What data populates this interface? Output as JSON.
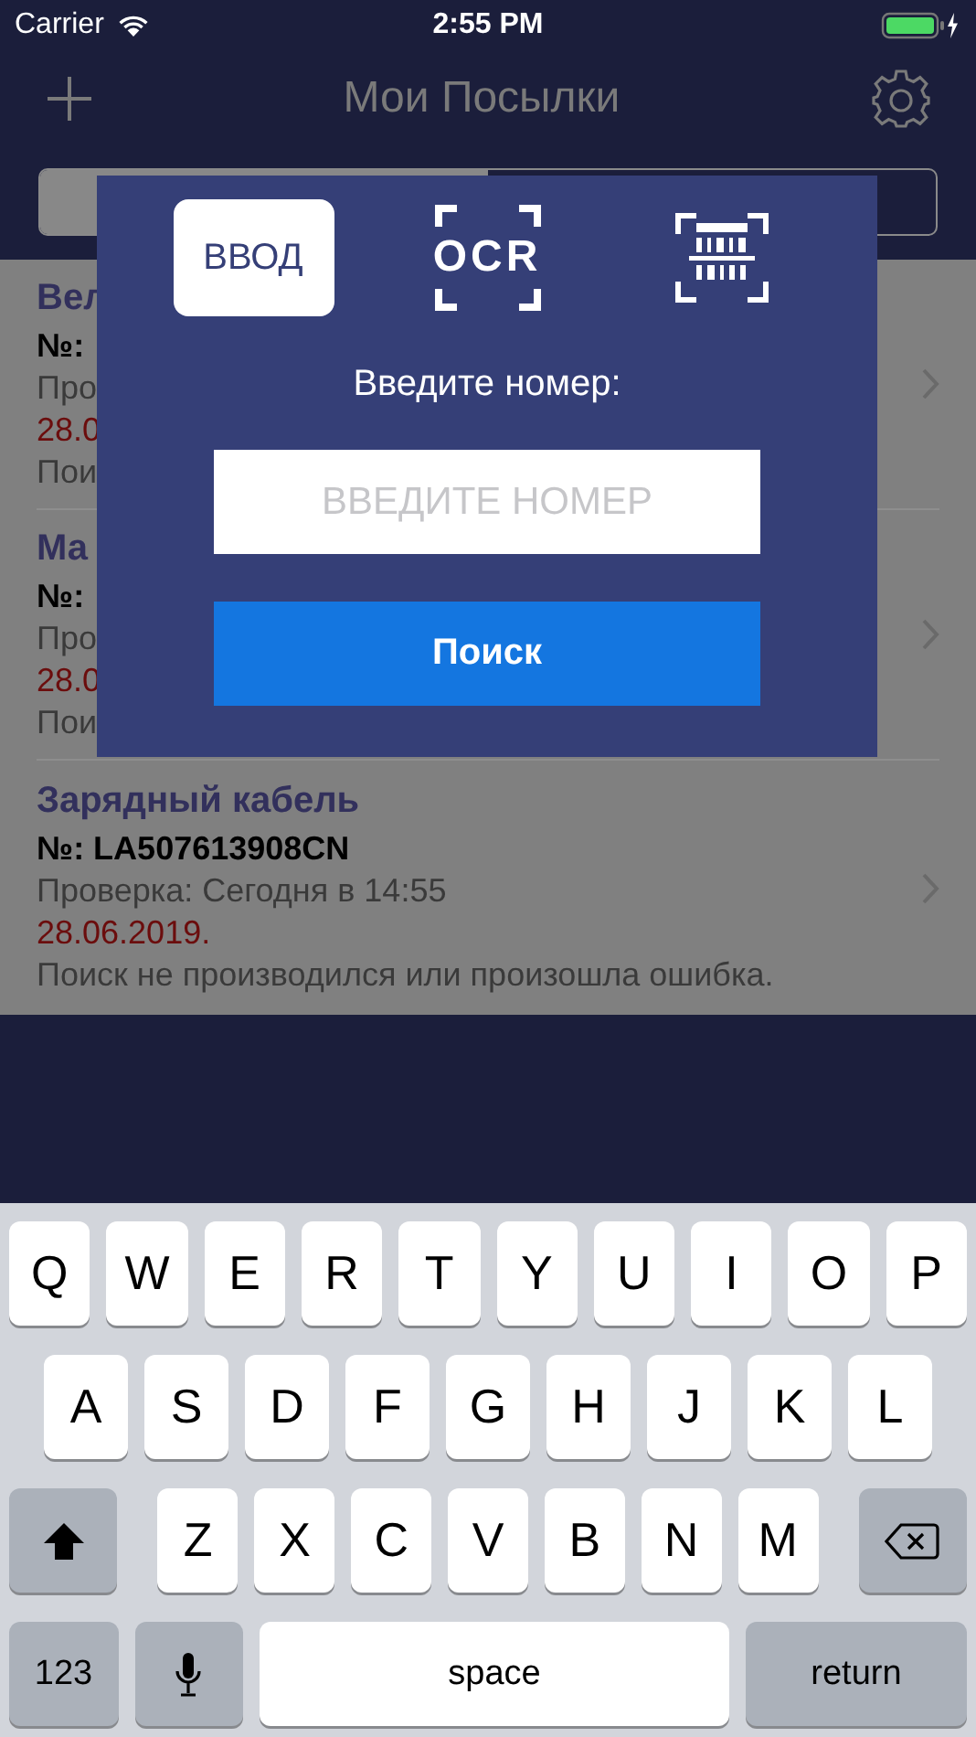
{
  "status_bar": {
    "carrier": "Carrier",
    "time": "2:55 PM"
  },
  "nav": {
    "title": "Мои Посылки"
  },
  "parcels": [
    {
      "name": "Вел",
      "number": "№:",
      "check": "Про",
      "date": "28.0",
      "status": "Пои"
    },
    {
      "name": "Ма",
      "number": "№:",
      "check": "Про",
      "date": "28.0",
      "status": "Пои"
    },
    {
      "name": "Зарядный кабель",
      "number": "№: LA507613908CN",
      "check": "Проверка: Сегодня в 14:55",
      "date": "28.06.2019.",
      "status": "Поиск не производился или произошла ошибка."
    }
  ],
  "dialog": {
    "modes": [
      {
        "kind": "text",
        "label": "ВВОД",
        "selected": true
      },
      {
        "kind": "ocr",
        "label": "OCR",
        "selected": false
      },
      {
        "kind": "barcode",
        "selected": false
      }
    ],
    "prompt": "Введите номер:",
    "placeholder": "ВВЕДИТЕ НОМЕР",
    "button": "Поиск"
  },
  "keyboard": [
    [
      {
        "kind": "letter",
        "label": "Q"
      },
      {
        "kind": "letter",
        "label": "W"
      },
      {
        "kind": "letter",
        "label": "E"
      },
      {
        "kind": "letter",
        "label": "R"
      },
      {
        "kind": "letter",
        "label": "T"
      },
      {
        "kind": "letter",
        "label": "Y"
      },
      {
        "kind": "letter",
        "label": "U"
      },
      {
        "kind": "letter",
        "label": "I"
      },
      {
        "kind": "letter",
        "label": "O"
      },
      {
        "kind": "letter",
        "label": "P"
      }
    ],
    [
      {
        "kind": "letter",
        "label": "A"
      },
      {
        "kind": "letter",
        "label": "S"
      },
      {
        "kind": "letter",
        "label": "D"
      },
      {
        "kind": "letter",
        "label": "F"
      },
      {
        "kind": "letter",
        "label": "G"
      },
      {
        "kind": "letter",
        "label": "H"
      },
      {
        "kind": "letter",
        "label": "J"
      },
      {
        "kind": "letter",
        "label": "K"
      },
      {
        "kind": "letter",
        "label": "L"
      }
    ],
    [
      {
        "kind": "shift"
      },
      {
        "kind": "letter",
        "label": "Z"
      },
      {
        "kind": "letter",
        "label": "X"
      },
      {
        "kind": "letter",
        "label": "C"
      },
      {
        "kind": "letter",
        "label": "V"
      },
      {
        "kind": "letter",
        "label": "B"
      },
      {
        "kind": "letter",
        "label": "N"
      },
      {
        "kind": "letter",
        "label": "M"
      },
      {
        "kind": "delete"
      }
    ],
    [
      {
        "kind": "mode",
        "label": "123"
      },
      {
        "kind": "mic"
      },
      {
        "kind": "space",
        "label": "space"
      },
      {
        "kind": "return",
        "label": "return"
      }
    ]
  ]
}
